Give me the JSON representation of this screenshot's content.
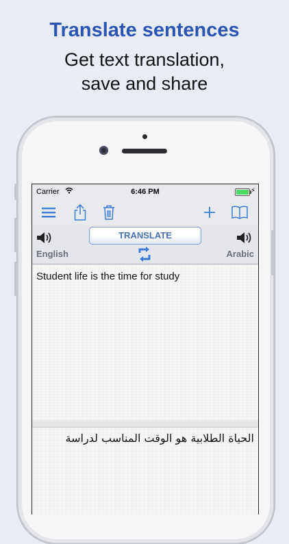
{
  "promo": {
    "headline": "Translate sentences",
    "subline_1": "Get text translation,",
    "subline_2": "save and share"
  },
  "status_bar": {
    "carrier": "Carrier",
    "time": "6:46 PM",
    "wifi_icon": "wifi-icon",
    "battery_icon": "battery-icon"
  },
  "toolbar": {
    "icons": [
      "menu-icon",
      "share-icon",
      "trash-icon",
      "plus-icon",
      "book-icon"
    ]
  },
  "translator": {
    "translate_label": "TRANSLATE",
    "source_language": "English",
    "target_language": "Arabic",
    "input_text": "Student life is the time for study",
    "output_text": "الحياة الطلابية هو الوقت المناسب لدراسة"
  },
  "colors": {
    "accent": "#2a55b0",
    "toolbar_icon": "#3a7bd5",
    "button_text": "#4a6fb3",
    "battery": "#4cd964"
  }
}
